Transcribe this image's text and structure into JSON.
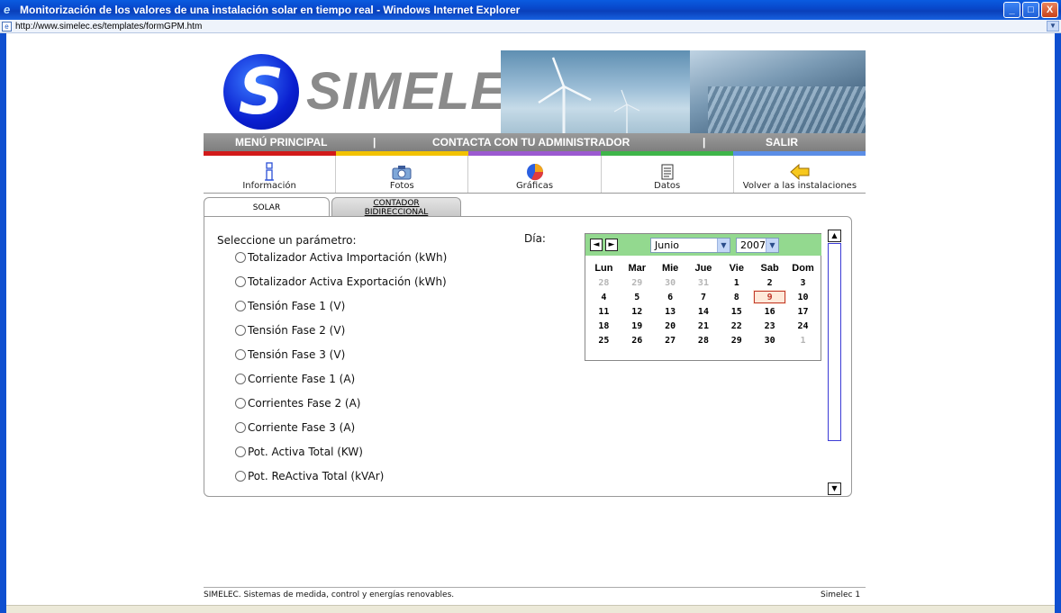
{
  "window": {
    "title": "Monitorización de los valores de una instalación solar en tiempo real - Windows Internet Explorer",
    "url": "http://www.simelec.es/templates/formGPM.htm",
    "minimize": "_",
    "maximize": "□",
    "close": "X"
  },
  "banner": {
    "logo_letter": "S",
    "logo_text": "SIMELEC"
  },
  "menu": {
    "principal": "MENÚ PRINCIPAL",
    "separator1": "|",
    "contacta": "CONTACTA CON TU ADMINISTRADOR",
    "separator2": "|",
    "salir": "SALIR"
  },
  "strip_colors": [
    "#d21a1a",
    "#f2c200",
    "#9b59d0",
    "#3fb54a",
    "#5b8ee6"
  ],
  "toolbar": {
    "items": [
      {
        "label": "Información",
        "icon": "info-icon"
      },
      {
        "label": "Fotos",
        "icon": "camera-icon"
      },
      {
        "label": "Gráficas",
        "icon": "pie-chart-icon"
      },
      {
        "label": "Datos",
        "icon": "document-icon"
      },
      {
        "label": "Volver a las instalaciones",
        "icon": "back-arrow-icon"
      }
    ]
  },
  "tabs": {
    "solar": "SOLAR",
    "contador_line1": "CONTADOR",
    "contador_line2": "BIDIRECCIONAL"
  },
  "form": {
    "prompt": "Seleccione un parámetro:",
    "dia_label": "Día:",
    "params": [
      "Totalizador Activa Importación (kWh)",
      "Totalizador Activa Exportación (kWh)",
      "Tensión Fase 1 (V)",
      "Tensión Fase 2 (V)",
      "Tensión Fase 3 (V)",
      "Corriente Fase 1 (A)",
      "Corrientes Fase 2 (A)",
      "Corriente Fase 3 (A)",
      "Pot. Activa Total (KW)",
      "Pot. ReActiva Total (kVAr)"
    ]
  },
  "calendar": {
    "month": "Junio",
    "year": "2007",
    "prev": "◄",
    "next": "►",
    "weekdays": [
      "Lun",
      "Mar",
      "Mie",
      "Jue",
      "Vie",
      "Sab",
      "Dom"
    ],
    "weeks": [
      [
        "28",
        "29",
        "30",
        "31",
        "1",
        "2",
        "3"
      ],
      [
        "4",
        "5",
        "6",
        "7",
        "8",
        "9",
        "10"
      ],
      [
        "11",
        "12",
        "13",
        "14",
        "15",
        "16",
        "17"
      ],
      [
        "18",
        "19",
        "20",
        "21",
        "22",
        "23",
        "24"
      ],
      [
        "25",
        "26",
        "27",
        "28",
        "29",
        "30",
        "1"
      ]
    ],
    "selected_day": "9"
  },
  "footer": {
    "left": "SIMELEC. Sistemas de medida, control y energías renovables.",
    "right": "Simelec 1"
  }
}
